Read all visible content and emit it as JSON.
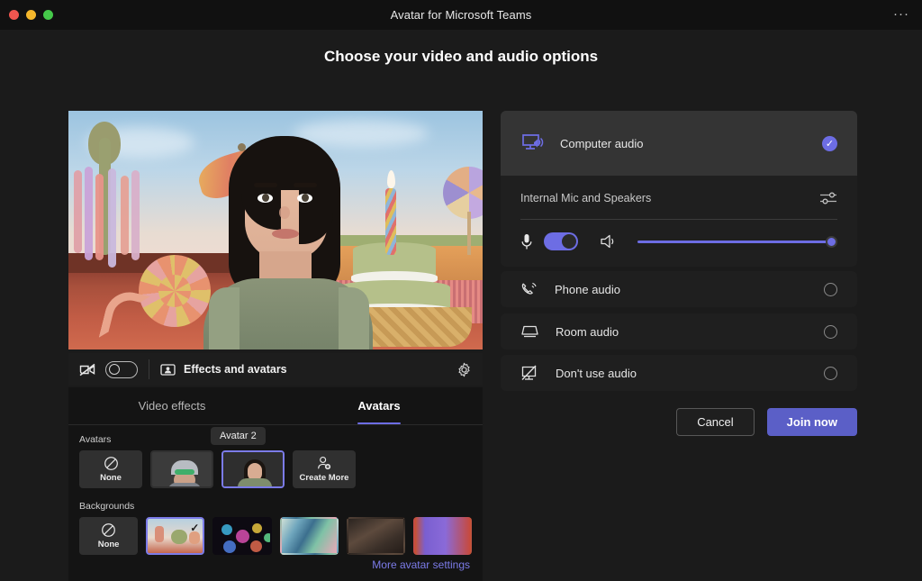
{
  "window": {
    "title": "Avatar for Microsoft Teams",
    "more_menu": "···"
  },
  "heading": "Choose your video and audio options",
  "preview_toolbar": {
    "camera_icon": "camera-off-icon",
    "camera_toggle_state": "off",
    "effects_label": "Effects and avatars",
    "effects_icon": "person-in-frame-icon",
    "settings_icon": "gear-icon"
  },
  "tabs": [
    {
      "label": "Video effects",
      "active": false
    },
    {
      "label": "Avatars",
      "active": true
    }
  ],
  "effects": {
    "avatars_label": "Avatars",
    "backgrounds_label": "Backgrounds",
    "tooltip": "Avatar 2",
    "more_link": "More avatar settings",
    "avatars": [
      {
        "label": "None",
        "icon": "circle-slash-icon",
        "selected": false
      },
      {
        "label": "",
        "icon": "avatar-thumbnail-1",
        "selected": false
      },
      {
        "label": "",
        "icon": "avatar-thumbnail-2",
        "selected": true
      },
      {
        "label": "Create More",
        "icon": "person-add-icon",
        "selected": false
      }
    ],
    "backgrounds": [
      {
        "label": "None",
        "icon": "circle-slash-icon",
        "selected": false
      },
      {
        "label": "",
        "icon": "background-candy-party",
        "selected": true
      },
      {
        "label": "",
        "icon": "background-bokeh",
        "selected": false
      },
      {
        "label": "",
        "icon": "background-abstract",
        "selected": false
      },
      {
        "label": "",
        "icon": "background-dark-room",
        "selected": false
      },
      {
        "label": "",
        "icon": "background-purple-room",
        "selected": false
      }
    ]
  },
  "audio": {
    "selected_option": "Computer audio",
    "computer_audio": {
      "label": "Computer audio",
      "icon": "monitor-speaker-icon",
      "selected": true,
      "device": "Internal Mic and Speakers",
      "tune_icon": "sliders-icon",
      "mic_icon": "microphone-icon",
      "mic_toggle_state": "on",
      "speaker_icon": "speaker-icon",
      "volume_percent": 100
    },
    "options": [
      {
        "label": "Phone audio",
        "icon": "phone-waves-icon",
        "selected": false
      },
      {
        "label": "Room audio",
        "icon": "room-icon",
        "selected": false
      },
      {
        "label": "Don't use audio",
        "icon": "monitor-slash-icon",
        "selected": false
      }
    ]
  },
  "buttons": {
    "cancel": "Cancel",
    "join": "Join now"
  },
  "colors": {
    "accent_purple": "#6d6de4",
    "join_button": "#5b5fc7",
    "link_purple": "#7b7be8",
    "window_bg": "#1b1b1b",
    "panel_bg": "#1f1f1f"
  }
}
